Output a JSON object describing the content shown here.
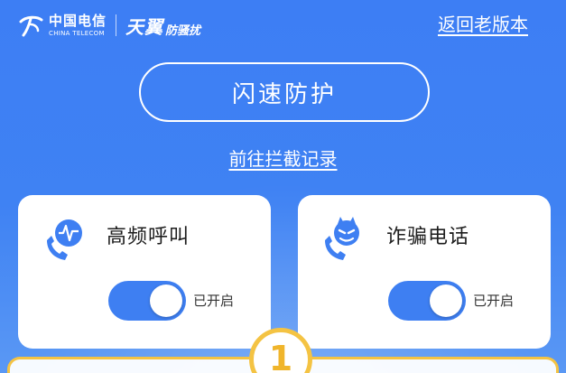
{
  "header": {
    "telecom_cn": "中国电信",
    "telecom_en": "CHINA TELECOM",
    "brand_main": "天翼",
    "brand_sub": "防骚扰",
    "old_version_label": "返回老版本"
  },
  "main": {
    "quick_protect_label": "闪速防护",
    "goto_record_label": "前往拦截记录"
  },
  "cards": [
    {
      "title": "高频呼叫",
      "icon": "high-frequency-call-icon",
      "status": "已开启",
      "enabled": true
    },
    {
      "title": "诈骗电话",
      "icon": "fraud-call-devil-icon",
      "status": "已开启",
      "enabled": true
    }
  ],
  "step_badge": {
    "number": "1"
  },
  "colors": {
    "background": "#3f82f3",
    "toggle_on": "#3e7ff2",
    "badge_accent": "#f4c343",
    "card_bg": "#ffffff"
  }
}
